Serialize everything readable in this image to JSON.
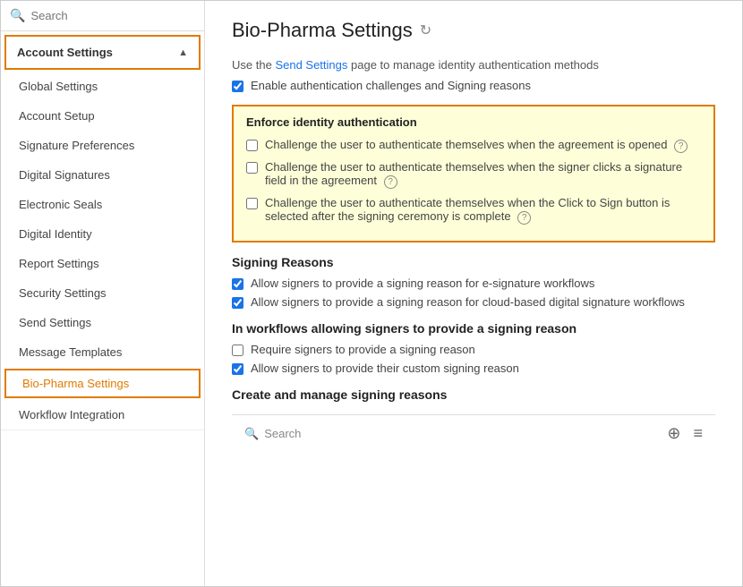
{
  "window": {
    "title": "Bio-Pharma Settings"
  },
  "sidebar": {
    "search_placeholder": "Search",
    "account_settings_label": "Account Settings",
    "items": [
      {
        "id": "global-settings",
        "label": "Global Settings",
        "active": false
      },
      {
        "id": "account-setup",
        "label": "Account Setup",
        "active": false
      },
      {
        "id": "signature-preferences",
        "label": "Signature Preferences",
        "active": false
      },
      {
        "id": "digital-signatures",
        "label": "Digital Signatures",
        "active": false
      },
      {
        "id": "electronic-seals",
        "label": "Electronic Seals",
        "active": false
      },
      {
        "id": "digital-identity",
        "label": "Digital Identity",
        "active": false
      },
      {
        "id": "report-settings",
        "label": "Report Settings",
        "active": false
      },
      {
        "id": "security-settings",
        "label": "Security Settings",
        "active": false
      },
      {
        "id": "send-settings",
        "label": "Send Settings",
        "active": false
      },
      {
        "id": "message-templates",
        "label": "Message Templates",
        "active": false
      },
      {
        "id": "bio-pharma-settings",
        "label": "Bio-Pharma Settings",
        "active": true
      },
      {
        "id": "workflow-integration",
        "label": "Workflow Integration",
        "active": false
      }
    ]
  },
  "main": {
    "page_title": "Bio-Pharma Settings",
    "refresh_icon": "↻",
    "description_text": "Use the",
    "description_link": "Send Settings",
    "description_rest": "page to manage identity authentication methods",
    "enable_auth_label": "Enable authentication challenges and Signing reasons",
    "enforce_section": {
      "title": "Enforce identity authentication",
      "items": [
        {
          "id": "challenge-open",
          "checked": false,
          "label": "Challenge the user to authenticate themselves when the agreement is opened",
          "has_help": true
        },
        {
          "id": "challenge-signature",
          "checked": false,
          "label": "Challenge the user to authenticate themselves when the signer clicks a signature field in the agreement",
          "has_help": true
        },
        {
          "id": "challenge-click-to-sign",
          "checked": false,
          "label": "Challenge the user to authenticate themselves when the Click to Sign button is selected after the signing ceremony is complete",
          "has_help": true
        }
      ]
    },
    "signing_reasons_section": {
      "title": "Signing Reasons",
      "items": [
        {
          "id": "allow-esig",
          "checked": true,
          "label": "Allow signers to provide a signing reason for e-signature workflows"
        },
        {
          "id": "allow-cloud-digital",
          "checked": true,
          "label": "Allow signers to provide a signing reason for cloud-based digital signature workflows"
        }
      ]
    },
    "in_workflows_section": {
      "title": "In workflows allowing signers to provide a signing reason",
      "items": [
        {
          "id": "require-signing-reason",
          "checked": false,
          "label": "Require signers to provide a signing reason"
        },
        {
          "id": "allow-custom-reason",
          "checked": true,
          "label": "Allow signers to provide their custom signing reason"
        }
      ]
    },
    "create_manage_section": {
      "title": "Create and manage signing reasons"
    },
    "bottom_search_placeholder": "Search",
    "add_icon": "⊕",
    "menu_icon": "≡"
  }
}
